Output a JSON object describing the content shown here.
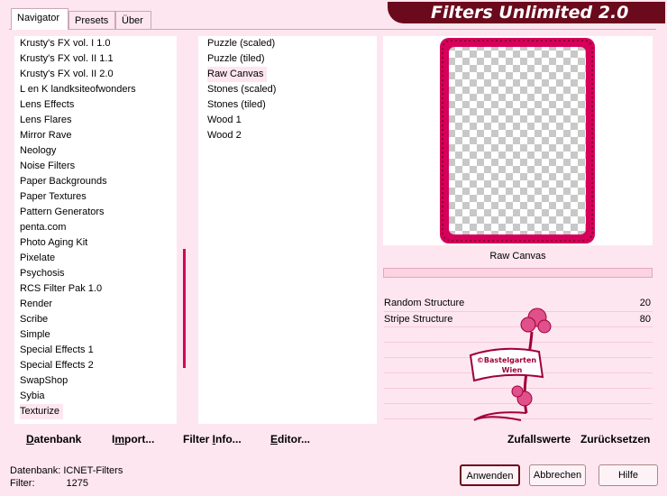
{
  "tabs": [
    {
      "label": "Navigator",
      "active": true
    },
    {
      "label": "Presets",
      "active": false
    },
    {
      "label": "Über",
      "active": false
    }
  ],
  "app_title": "Filters Unlimited 2.0",
  "categories": [
    "Krusty's FX vol. I 1.0",
    "Krusty's FX vol. II 1.1",
    "Krusty's FX vol. II 2.0",
    "L en K landksiteofwonders",
    "Lens Effects",
    "Lens Flares",
    "Mirror Rave",
    "Neology",
    "Noise Filters",
    "Paper Backgrounds",
    "Paper Textures",
    "Pattern Generators",
    "penta.com",
    "Photo Aging Kit",
    "Pixelate",
    "Psychosis",
    "RCS Filter Pak 1.0",
    "Render",
    "Scribe",
    "Simple",
    "Special Effects 1",
    "Special Effects 2",
    "SwapShop",
    "Sybia",
    "Texturize"
  ],
  "selected_category": "Texturize",
  "filters": [
    "Puzzle (scaled)",
    "Puzzle (tiled)",
    "Raw Canvas",
    "Stones (scaled)",
    "Stones (tiled)",
    "Wood 1",
    "Wood 2"
  ],
  "selected_filter": "Raw Canvas",
  "preview_label": "Raw Canvas",
  "params": [
    {
      "name": "Random Structure",
      "value": "20"
    },
    {
      "name": "Stripe Structure",
      "value": "80"
    }
  ],
  "watermark": {
    "line1": "©Bastelgarten",
    "line2": "Wien"
  },
  "toolbar": {
    "datenbank": {
      "u": "D",
      "rest": "atenbank"
    },
    "import": {
      "pre": "I",
      "u": "m",
      "rest": "port..."
    },
    "filterinfo": {
      "pre": "Filter ",
      "u": "I",
      "rest": "nfo..."
    },
    "editor": {
      "u": "E",
      "rest": "ditor..."
    },
    "zufallswerte": "Zufallswerte",
    "zuruecksetzen": "Zurücksetzen"
  },
  "status": {
    "db_label": "Datenbank:",
    "db_value": "ICNET-Filters",
    "filter_label": "Filter:",
    "filter_value": "1275"
  },
  "buttons": {
    "apply": "Anwenden",
    "cancel": "Abbrechen",
    "help": "Hilfe"
  },
  "colors": {
    "accent": "#d6005a",
    "banner": "#6b0a1c",
    "background": "#fde6ef"
  }
}
